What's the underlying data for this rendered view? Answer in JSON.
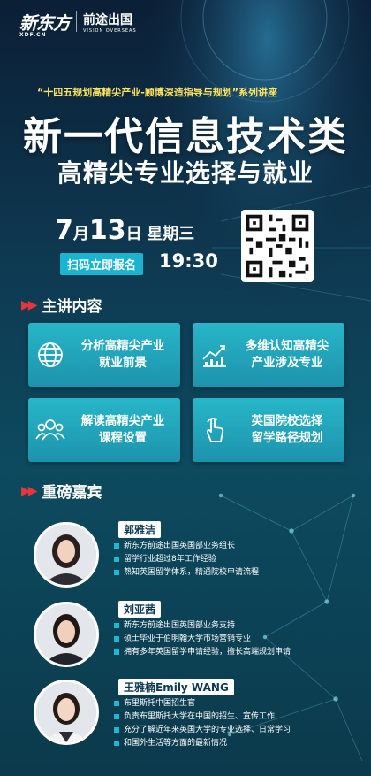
{
  "header": {
    "logo_xdf": "新东方",
    "logo_xdf_sub": "XDF.CN",
    "logo_vo": "前途出国",
    "logo_vo_sub": "VISION OVERSEAS"
  },
  "series_line": "“十四五规划高精尖产业-顾博深造指导与规划”系列讲座",
  "title_main": "新一代信息技术类",
  "title_sub": "高精尖专业选择与就业",
  "event": {
    "month": "7",
    "month_unit": "月",
    "day": "13",
    "day_unit": "日",
    "weekday": "星期三",
    "cta": "扫码立即报名",
    "time": "19:30"
  },
  "section_content": {
    "title": "主讲内容"
  },
  "cards": [
    {
      "text1": "分析高精尖产业",
      "text2": "就业前景",
      "icon": "globe-icon"
    },
    {
      "text1": "多维认知高精尖",
      "text2": "产业涉及专业",
      "icon": "chart-icon"
    },
    {
      "text1": "解读高精尖产业",
      "text2": "课程设置",
      "icon": "people-icon"
    },
    {
      "text1": "英国院校选择",
      "text2": "留学路径规划",
      "icon": "hand-pointer-icon"
    }
  ],
  "section_guests": {
    "title": "重磅嘉宾"
  },
  "guests": [
    {
      "name": "郭雅洁",
      "bullets": [
        "新东方前途出国英国部业务组长",
        "留学行业超过8年工作经验",
        "熟知英国留学体系，精通院校申请流程"
      ]
    },
    {
      "name": "刘亚茜",
      "bullets": [
        "新东方前途出国英国部业务支持",
        "硕士毕业于伯明翰大学市场营销专业",
        "拥有多年英国留学申请经验，擅长高端规划申请"
      ]
    },
    {
      "name": "王雅楠Emily WANG",
      "bullets": [
        "布里斯托中国招生官",
        "负责布里斯托大学在中国的招生、宣传工作",
        "充分了解近年来英国大学的专业选择、日常学习",
        "和国外生活等方面的最新情况"
      ]
    }
  ],
  "colors": {
    "accent": "#19b4d0",
    "arrow": "#e8353b",
    "highlight": "#ffe45e"
  }
}
